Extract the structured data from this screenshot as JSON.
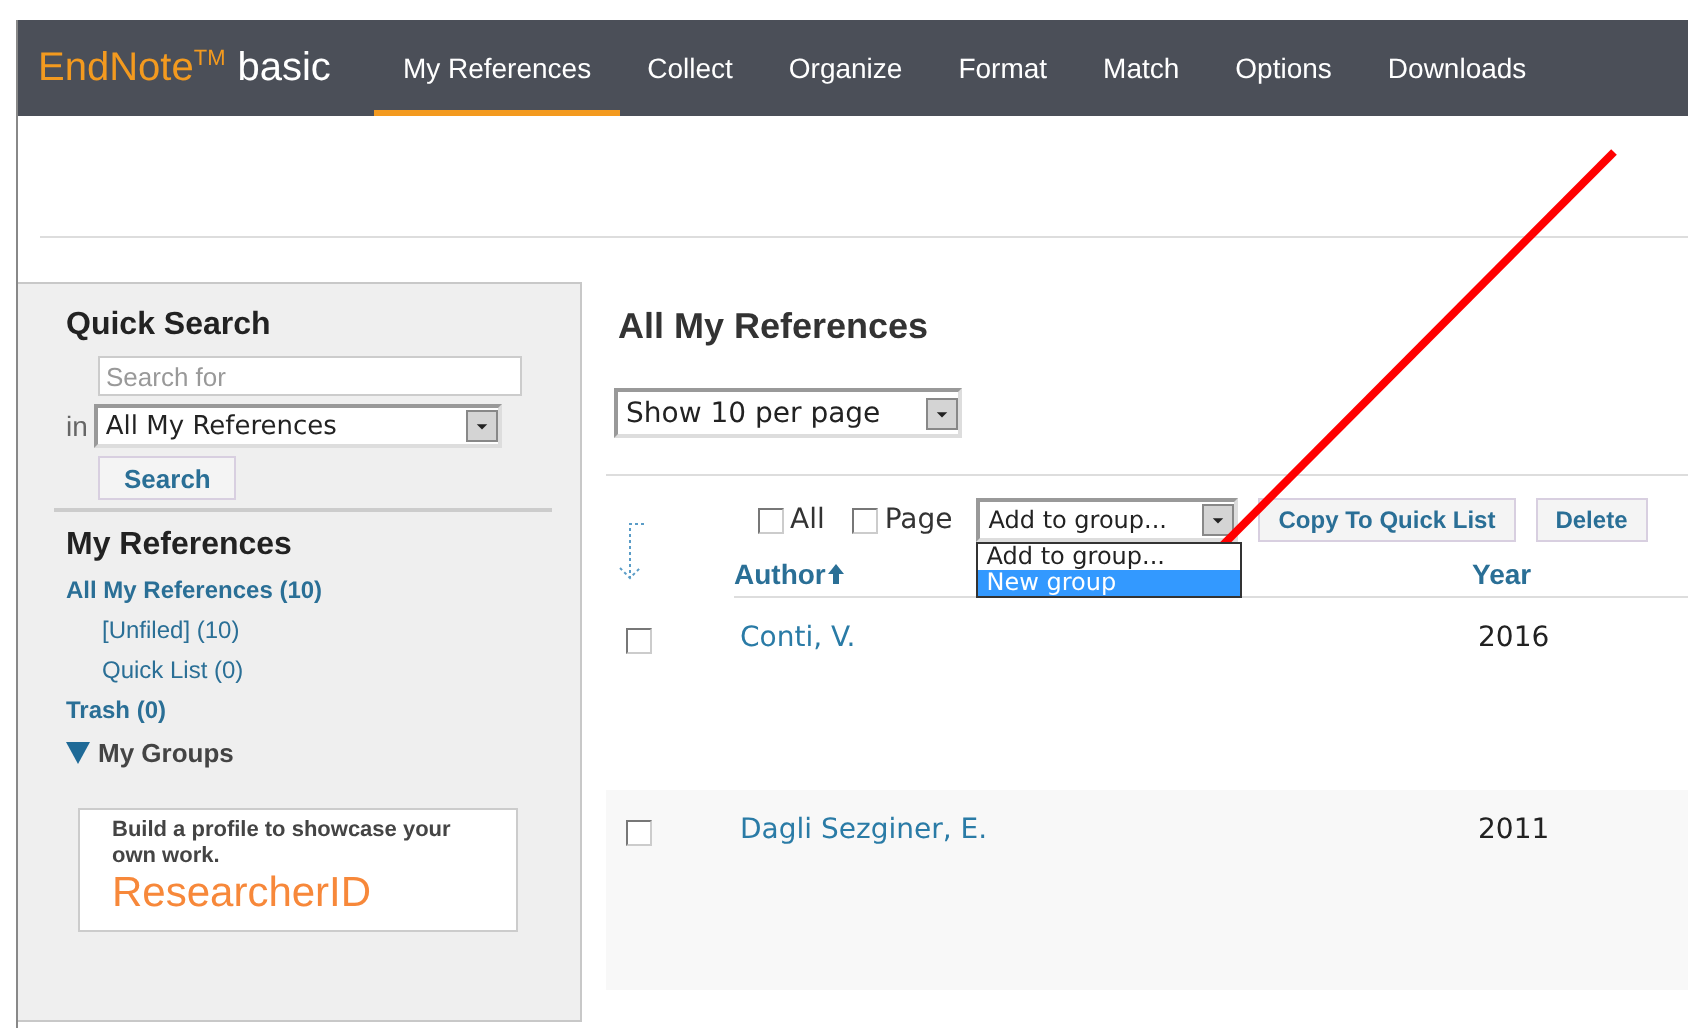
{
  "header": {
    "logo": "EndNote$^{TM}$",
    "edition": "basic"
  },
  "nav": [
    {
      "label": "My References",
      "selected": true
    },
    {
      "label": "Collect",
      "selected": false
    },
    {
      "label": "Organize",
      "selected": false
    },
    {
      "label": "Format",
      "selected": false
    },
    {
      "label": "Match",
      "selected": false
    },
    {
      "label": "Options",
      "selected": false
    },
    {
      "label": "Downloads",
      "selected": false
    }
  ],
  "sidebar": {
    "quick_search": {
      "title": "Quick Search",
      "placeholder": "Search for",
      "in_label": "in",
      "scope": "All My References",
      "button": "Search"
    },
    "my_references": {
      "title": "My References",
      "items": [
        {
          "label": "All My References (10)",
          "children": [
            {
              "label": "[Unfiled] (10)"
            },
            {
              "label": "Quick List (0)"
            }
          ]
        },
        {
          "label": "Trash (0)"
        },
        {
          "label": "My Groups",
          "expanded": true
        }
      ]
    },
    "promo": {
      "text": "Build a profile to showcase your own work.",
      "brand": "ResearcherID"
    }
  },
  "main": {
    "title": "All My References",
    "page_size": "Show 10 per page",
    "toolbar": {
      "checkboxes": [
        {
          "label": "All",
          "checked": false
        },
        {
          "label": "Page",
          "checked": false
        }
      ],
      "group_select": "Add to group...",
      "group_options": [
        {
          "label": "Add to group...",
          "selected": false
        },
        {
          "label": "New group",
          "selected": true
        }
      ],
      "buttons": [
        "Copy To Quick List",
        "Delete"
      ]
    },
    "columns": [
      "Author",
      "Year"
    ],
    "rows": [
      {
        "author": "Conti, V.",
        "year": "2016",
        "checked": false
      },
      {
        "author": "Dagli Sezginer, E.",
        "year": "2011",
        "checked": false
      }
    ]
  }
}
